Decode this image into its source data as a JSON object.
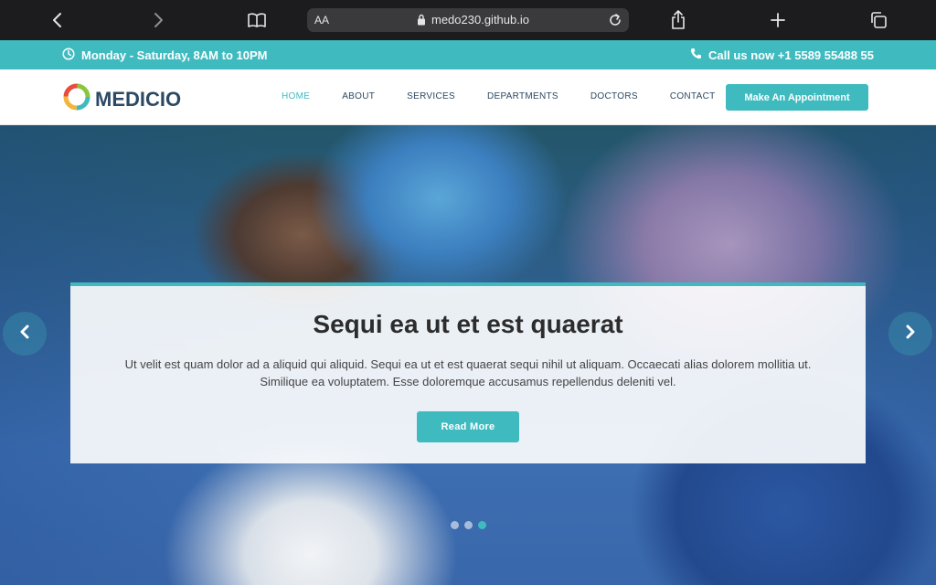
{
  "browser": {
    "text_size_label": "AA",
    "url": "medo230.github.io"
  },
  "topbar": {
    "hours": "Monday - Saturday, 8AM to 10PM",
    "phone": "Call us now +1 5589 55488 55"
  },
  "header": {
    "logo": "MEDICIO",
    "nav": [
      "HOME",
      "ABOUT",
      "SERVICES",
      "DEPARTMENTS",
      "DOCTORS",
      "CONTACT"
    ],
    "active_nav": "HOME",
    "cta": "Make An Appointment"
  },
  "hero": {
    "title": "Sequi ea ut et est quaerat",
    "text": "Ut velit est quam dolor ad a aliquid qui aliquid. Sequi ea ut et est quaerat sequi nihil ut aliquam. Occaecati alias dolorem mollitia ut. Similique ea voluptatem. Esse doloremque accusamus repellendus deleniti vel.",
    "button": "Read More",
    "slide_count": 3,
    "active_slide": 3
  },
  "colors": {
    "accent": "#3fbbc0",
    "heading": "#2c4964"
  },
  "icons": [
    "back-icon",
    "forward-icon",
    "bookmarks-icon",
    "lock-icon",
    "reload-icon",
    "share-icon",
    "new-tab-icon",
    "tabs-icon",
    "clock-icon",
    "phone-icon",
    "logo-ring-icon",
    "chevron-left-icon",
    "chevron-right-icon"
  ]
}
